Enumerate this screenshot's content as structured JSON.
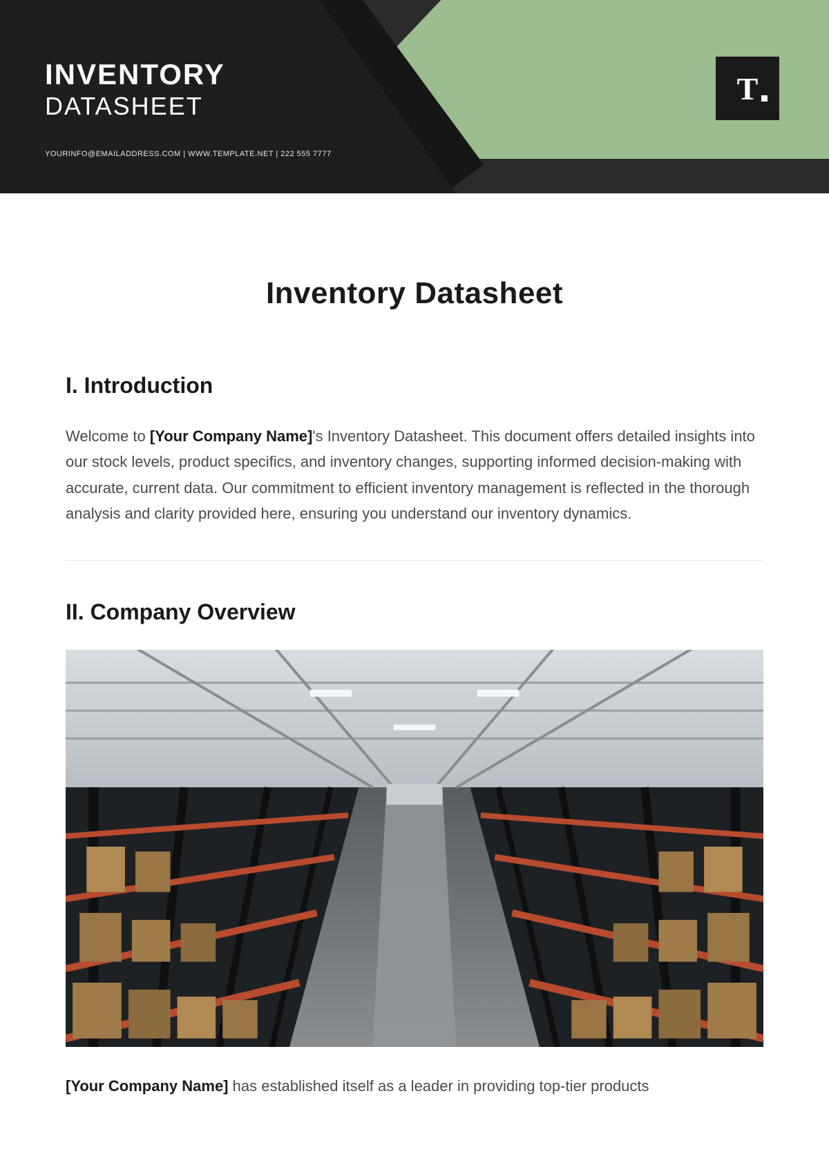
{
  "header": {
    "title_line1": "INVENTORY",
    "title_line2": "DATASHEET",
    "contact": "YOURINFO@EMAILADDRESS.COM | WWW.TEMPLATE.NET | 222 555 7777",
    "logo_letter": "T"
  },
  "page": {
    "title": "Inventory Datasheet"
  },
  "sections": {
    "intro": {
      "heading": "I. Introduction",
      "text_pre": "Welcome to ",
      "placeholder": "[Your Company Name]",
      "text_post": "'s Inventory Datasheet. This document offers detailed insights into our stock levels, product specifics, and inventory changes, supporting informed decision-making with accurate, current data. Our commitment to efficient inventory management is reflected in the thorough analysis and clarity provided here, ensuring you understand our inventory dynamics."
    },
    "overview": {
      "heading": "II. Company Overview",
      "truncated_placeholder": "[Your Company Name]",
      "truncated_text": " has established itself as a leader in providing top-tier products"
    }
  }
}
